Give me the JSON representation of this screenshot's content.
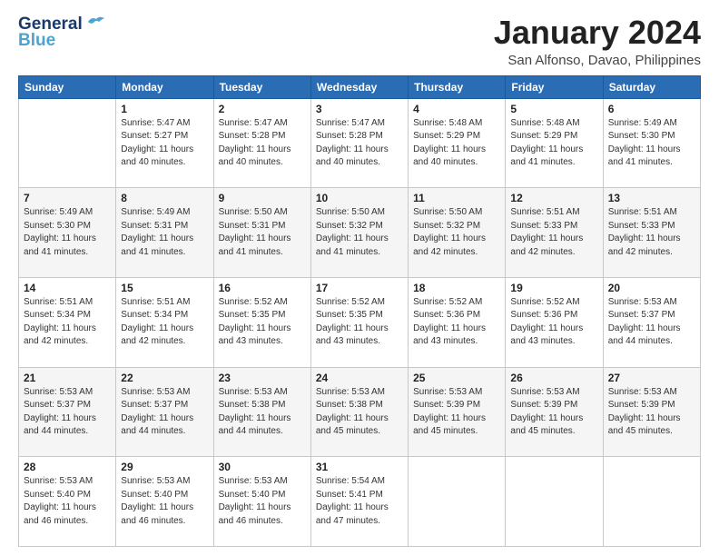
{
  "header": {
    "logo_line1": "General",
    "logo_line2": "Blue",
    "month_title": "January 2024",
    "location": "San Alfonso, Davao, Philippines"
  },
  "weekdays": [
    "Sunday",
    "Monday",
    "Tuesday",
    "Wednesday",
    "Thursday",
    "Friday",
    "Saturday"
  ],
  "weeks": [
    [
      {
        "day": "",
        "info": ""
      },
      {
        "day": "1",
        "info": "Sunrise: 5:47 AM\nSunset: 5:27 PM\nDaylight: 11 hours\nand 40 minutes."
      },
      {
        "day": "2",
        "info": "Sunrise: 5:47 AM\nSunset: 5:28 PM\nDaylight: 11 hours\nand 40 minutes."
      },
      {
        "day": "3",
        "info": "Sunrise: 5:47 AM\nSunset: 5:28 PM\nDaylight: 11 hours\nand 40 minutes."
      },
      {
        "day": "4",
        "info": "Sunrise: 5:48 AM\nSunset: 5:29 PM\nDaylight: 11 hours\nand 40 minutes."
      },
      {
        "day": "5",
        "info": "Sunrise: 5:48 AM\nSunset: 5:29 PM\nDaylight: 11 hours\nand 41 minutes."
      },
      {
        "day": "6",
        "info": "Sunrise: 5:49 AM\nSunset: 5:30 PM\nDaylight: 11 hours\nand 41 minutes."
      }
    ],
    [
      {
        "day": "7",
        "info": "Sunrise: 5:49 AM\nSunset: 5:30 PM\nDaylight: 11 hours\nand 41 minutes."
      },
      {
        "day": "8",
        "info": "Sunrise: 5:49 AM\nSunset: 5:31 PM\nDaylight: 11 hours\nand 41 minutes."
      },
      {
        "day": "9",
        "info": "Sunrise: 5:50 AM\nSunset: 5:31 PM\nDaylight: 11 hours\nand 41 minutes."
      },
      {
        "day": "10",
        "info": "Sunrise: 5:50 AM\nSunset: 5:32 PM\nDaylight: 11 hours\nand 41 minutes."
      },
      {
        "day": "11",
        "info": "Sunrise: 5:50 AM\nSunset: 5:32 PM\nDaylight: 11 hours\nand 42 minutes."
      },
      {
        "day": "12",
        "info": "Sunrise: 5:51 AM\nSunset: 5:33 PM\nDaylight: 11 hours\nand 42 minutes."
      },
      {
        "day": "13",
        "info": "Sunrise: 5:51 AM\nSunset: 5:33 PM\nDaylight: 11 hours\nand 42 minutes."
      }
    ],
    [
      {
        "day": "14",
        "info": "Sunrise: 5:51 AM\nSunset: 5:34 PM\nDaylight: 11 hours\nand 42 minutes."
      },
      {
        "day": "15",
        "info": "Sunrise: 5:51 AM\nSunset: 5:34 PM\nDaylight: 11 hours\nand 42 minutes."
      },
      {
        "day": "16",
        "info": "Sunrise: 5:52 AM\nSunset: 5:35 PM\nDaylight: 11 hours\nand 43 minutes."
      },
      {
        "day": "17",
        "info": "Sunrise: 5:52 AM\nSunset: 5:35 PM\nDaylight: 11 hours\nand 43 minutes."
      },
      {
        "day": "18",
        "info": "Sunrise: 5:52 AM\nSunset: 5:36 PM\nDaylight: 11 hours\nand 43 minutes."
      },
      {
        "day": "19",
        "info": "Sunrise: 5:52 AM\nSunset: 5:36 PM\nDaylight: 11 hours\nand 43 minutes."
      },
      {
        "day": "20",
        "info": "Sunrise: 5:53 AM\nSunset: 5:37 PM\nDaylight: 11 hours\nand 44 minutes."
      }
    ],
    [
      {
        "day": "21",
        "info": "Sunrise: 5:53 AM\nSunset: 5:37 PM\nDaylight: 11 hours\nand 44 minutes."
      },
      {
        "day": "22",
        "info": "Sunrise: 5:53 AM\nSunset: 5:37 PM\nDaylight: 11 hours\nand 44 minutes."
      },
      {
        "day": "23",
        "info": "Sunrise: 5:53 AM\nSunset: 5:38 PM\nDaylight: 11 hours\nand 44 minutes."
      },
      {
        "day": "24",
        "info": "Sunrise: 5:53 AM\nSunset: 5:38 PM\nDaylight: 11 hours\nand 45 minutes."
      },
      {
        "day": "25",
        "info": "Sunrise: 5:53 AM\nSunset: 5:39 PM\nDaylight: 11 hours\nand 45 minutes."
      },
      {
        "day": "26",
        "info": "Sunrise: 5:53 AM\nSunset: 5:39 PM\nDaylight: 11 hours\nand 45 minutes."
      },
      {
        "day": "27",
        "info": "Sunrise: 5:53 AM\nSunset: 5:39 PM\nDaylight: 11 hours\nand 45 minutes."
      }
    ],
    [
      {
        "day": "28",
        "info": "Sunrise: 5:53 AM\nSunset: 5:40 PM\nDaylight: 11 hours\nand 46 minutes."
      },
      {
        "day": "29",
        "info": "Sunrise: 5:53 AM\nSunset: 5:40 PM\nDaylight: 11 hours\nand 46 minutes."
      },
      {
        "day": "30",
        "info": "Sunrise: 5:53 AM\nSunset: 5:40 PM\nDaylight: 11 hours\nand 46 minutes."
      },
      {
        "day": "31",
        "info": "Sunrise: 5:54 AM\nSunset: 5:41 PM\nDaylight: 11 hours\nand 47 minutes."
      },
      {
        "day": "",
        "info": ""
      },
      {
        "day": "",
        "info": ""
      },
      {
        "day": "",
        "info": ""
      }
    ]
  ]
}
